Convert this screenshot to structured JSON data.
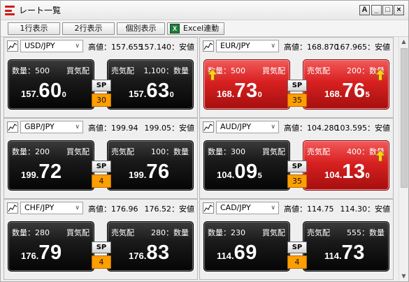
{
  "window": {
    "title": "レート一覧",
    "controls": [
      "A",
      "_",
      "□",
      "×"
    ]
  },
  "toolbar": {
    "one_row": "1行表示",
    "two_row": "2行表示",
    "individual": "個別表示",
    "excel": "Excel連動",
    "excel_icon": "X"
  },
  "panels": [
    {
      "pair": "USD/JPY",
      "high": "高値：157.655",
      "low": "157.140：安値",
      "bid": {
        "label_left": "数量：500",
        "label_right": "買気配",
        "small": "157.",
        "big": "60",
        "tiny": "0",
        "theme": "black",
        "arrow": false
      },
      "ask": {
        "label_left": "売気配",
        "label_right": "1,100：数量",
        "small": "157.",
        "big": "63",
        "tiny": "0",
        "theme": "black",
        "arrow": false
      },
      "sp": {
        "label": "SP",
        "value": "30"
      }
    },
    {
      "pair": "EUR/JPY",
      "high": "高値：168.870",
      "low": "167.965：安値",
      "bid": {
        "label_left": "数量：500",
        "label_right": "買気配",
        "small": "168.",
        "big": "73",
        "tiny": "0",
        "theme": "red",
        "arrow": true
      },
      "ask": {
        "label_left": "売気配",
        "label_right": "200：数量",
        "small": "168.",
        "big": "76",
        "tiny": "5",
        "theme": "red",
        "arrow": true
      },
      "sp": {
        "label": "SP",
        "value": "35"
      }
    },
    {
      "pair": "GBP/JPY",
      "high": "高値：199.94",
      "low": "199.05：安値",
      "bid": {
        "label_left": "数量：200",
        "label_right": "買気配",
        "small": "199.",
        "big": "72",
        "tiny": "",
        "theme": "black",
        "arrow": false
      },
      "ask": {
        "label_left": "売気配",
        "label_right": "100：数量",
        "small": "199.",
        "big": "76",
        "tiny": "",
        "theme": "black",
        "arrow": false
      },
      "sp": {
        "label": "SP",
        "value": "4"
      }
    },
    {
      "pair": "AUD/JPY",
      "high": "高値：104.280",
      "low": "103.595：安値",
      "bid": {
        "label_left": "数量：300",
        "label_right": "買気配",
        "small": "104.",
        "big": "09",
        "tiny": "5",
        "theme": "black",
        "arrow": false
      },
      "ask": {
        "label_left": "売気配",
        "label_right": "400：数量",
        "small": "104.",
        "big": "13",
        "tiny": "0",
        "theme": "red",
        "arrow": true
      },
      "sp": {
        "label": "SP",
        "value": "35"
      }
    },
    {
      "pair": "CHF/JPY",
      "high": "高値：176.96",
      "low": "176.52：安値",
      "bid": {
        "label_left": "数量：280",
        "label_right": "買気配",
        "small": "176.",
        "big": "79",
        "tiny": "",
        "theme": "black",
        "arrow": false
      },
      "ask": {
        "label_left": "売気配",
        "label_right": "280：数量",
        "small": "176.",
        "big": "83",
        "tiny": "",
        "theme": "black",
        "arrow": false
      },
      "sp": {
        "label": "SP",
        "value": "4"
      }
    },
    {
      "pair": "CAD/JPY",
      "high": "高値：114.75",
      "low": "114.30：安値",
      "bid": {
        "label_left": "数量：230",
        "label_right": "買気配",
        "small": "114.",
        "big": "69",
        "tiny": "",
        "theme": "black",
        "arrow": false
      },
      "ask": {
        "label_left": "売気配",
        "label_right": "555：数量",
        "small": "114.",
        "big": "73",
        "tiny": "",
        "theme": "black",
        "arrow": false
      },
      "sp": {
        "label": "SP",
        "value": "4"
      }
    }
  ],
  "colors": {
    "up_red": "#d82020",
    "card_black": "#1a1a1a",
    "spread_orange": "#ff9e00",
    "arrow_yellow": "#ffd21a"
  }
}
